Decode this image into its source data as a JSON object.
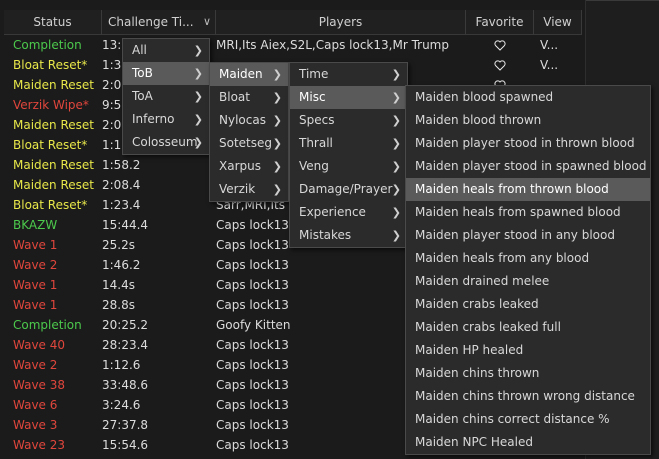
{
  "colors": {
    "green": "#4cc94c",
    "yellow": "#e8e84a",
    "red": "#e0463c",
    "white": "#dcdcdc"
  },
  "header": {
    "status": "Status",
    "challenge_time": "Challenge Ti...",
    "players": "Players",
    "favorite": "Favorite",
    "view": "View"
  },
  "rows": [
    {
      "status": "Completion",
      "color": "green",
      "time": "13:0",
      "players": "MRI,Its Aiex,S2L,Caps lock13,Mr Trump",
      "fav": true,
      "view": "V..."
    },
    {
      "status": "Bloat Reset*",
      "color": "yellow",
      "time": "1:30",
      "players": "",
      "fav": true,
      "view": "V..."
    },
    {
      "status": "Maiden Reset",
      "color": "yellow",
      "time": "2:0",
      "players": "",
      "fav": true,
      "view": ""
    },
    {
      "status": "Verzik Wipe*",
      "color": "red",
      "time": "9:5",
      "players": "",
      "fav": false,
      "view": ""
    },
    {
      "status": "Maiden Reset",
      "color": "yellow",
      "time": "2:0",
      "players": "",
      "fav": false,
      "view": ""
    },
    {
      "status": "Bloat Reset*",
      "color": "yellow",
      "time": "1:10",
      "players": "",
      "fav": false,
      "view": ""
    },
    {
      "status": "Maiden Reset",
      "color": "yellow",
      "time": "1:58.2",
      "players": "",
      "fav": false,
      "view": ""
    },
    {
      "status": "Maiden Reset",
      "color": "yellow",
      "time": "2:08.4",
      "players": "",
      "fav": false,
      "view": ""
    },
    {
      "status": "Bloat Reset*",
      "color": "yellow",
      "time": "1:23.4",
      "players": "Sarr,MRI,Its",
      "fav": false,
      "view": ""
    },
    {
      "status": "BKAZW",
      "color": "green",
      "time": "15:44.4",
      "players": "Caps lock13",
      "fav": false,
      "view": ""
    },
    {
      "status": "Wave 1",
      "color": "red",
      "time": "25.2s",
      "players": "Caps lock13",
      "fav": false,
      "view": ""
    },
    {
      "status": "Wave 2",
      "color": "red",
      "time": "1:46.2",
      "players": "Caps lock13",
      "fav": false,
      "view": ""
    },
    {
      "status": "Wave 1",
      "color": "red",
      "time": "14.4s",
      "players": "Caps lock13",
      "fav": false,
      "view": ""
    },
    {
      "status": "Wave 1",
      "color": "red",
      "time": "28.8s",
      "players": "Caps lock13",
      "fav": false,
      "view": ""
    },
    {
      "status": "Completion",
      "color": "green",
      "time": "20:25.2",
      "players": "Goofy Kitten",
      "fav": false,
      "view": ""
    },
    {
      "status": "Wave 40",
      "color": "red",
      "time": "28:23.4",
      "players": "Caps lock13",
      "fav": false,
      "view": ""
    },
    {
      "status": "Wave 2",
      "color": "red",
      "time": "1:12.6",
      "players": "Caps lock13",
      "fav": false,
      "view": ""
    },
    {
      "status": "Wave 38",
      "color": "red",
      "time": "33:48.6",
      "players": "Caps lock13",
      "fav": false,
      "view": ""
    },
    {
      "status": "Wave 6",
      "color": "red",
      "time": "3:24.6",
      "players": "Caps lock13",
      "fav": false,
      "view": ""
    },
    {
      "status": "Wave 3",
      "color": "red",
      "time": "27:37.8",
      "players": "Caps lock13",
      "fav": false,
      "view": ""
    },
    {
      "status": "Wave 23",
      "color": "red",
      "time": "15:54.6",
      "players": "Caps lock13",
      "fav": false,
      "view": ""
    }
  ],
  "menu1": [
    {
      "label": "All",
      "submenu": true,
      "selected": false
    },
    {
      "label": "ToB",
      "submenu": true,
      "selected": true
    },
    {
      "label": "ToA",
      "submenu": true,
      "selected": false
    },
    {
      "label": "Inferno",
      "submenu": true,
      "selected": false
    },
    {
      "label": "Colosseum",
      "submenu": true,
      "selected": false
    }
  ],
  "menu2": [
    {
      "label": "Maiden",
      "submenu": true,
      "selected": true
    },
    {
      "label": "Bloat",
      "submenu": true,
      "selected": false
    },
    {
      "label": "Nylocas",
      "submenu": true,
      "selected": false
    },
    {
      "label": "Sotetseg",
      "submenu": true,
      "selected": false
    },
    {
      "label": "Xarpus",
      "submenu": true,
      "selected": false
    },
    {
      "label": "Verzik",
      "submenu": true,
      "selected": false
    }
  ],
  "menu3": [
    {
      "label": "Time",
      "submenu": true,
      "selected": false
    },
    {
      "label": "Misc",
      "submenu": true,
      "selected": true
    },
    {
      "label": "Specs",
      "submenu": true,
      "selected": false
    },
    {
      "label": "Thrall",
      "submenu": true,
      "selected": false
    },
    {
      "label": "Veng",
      "submenu": true,
      "selected": false
    },
    {
      "label": "Damage/Prayer",
      "submenu": true,
      "selected": false
    },
    {
      "label": "Experience",
      "submenu": true,
      "selected": false
    },
    {
      "label": "Mistakes",
      "submenu": true,
      "selected": false
    }
  ],
  "menu4": [
    {
      "label": "Maiden blood spawned",
      "submenu": false,
      "selected": false
    },
    {
      "label": "Maiden blood thrown",
      "submenu": false,
      "selected": false
    },
    {
      "label": "Maiden player stood in thrown blood",
      "submenu": false,
      "selected": false
    },
    {
      "label": "Maiden player stood in spawned blood",
      "submenu": false,
      "selected": false
    },
    {
      "label": "Maiden heals from thrown blood",
      "submenu": false,
      "selected": true
    },
    {
      "label": "Maiden heals from spawned blood",
      "submenu": false,
      "selected": false
    },
    {
      "label": "Maiden player stood in any blood",
      "submenu": false,
      "selected": false
    },
    {
      "label": "Maiden heals from any blood",
      "submenu": false,
      "selected": false
    },
    {
      "label": "Maiden drained melee",
      "submenu": false,
      "selected": false
    },
    {
      "label": "Maiden crabs leaked",
      "submenu": false,
      "selected": false
    },
    {
      "label": "Maiden crabs leaked full",
      "submenu": false,
      "selected": false
    },
    {
      "label": "Maiden HP healed",
      "submenu": false,
      "selected": false
    },
    {
      "label": "Maiden chins thrown",
      "submenu": false,
      "selected": false
    },
    {
      "label": "Maiden chins thrown wrong distance",
      "submenu": false,
      "selected": false
    },
    {
      "label": "Maiden chins correct distance %",
      "submenu": false,
      "selected": false
    },
    {
      "label": "Maiden NPC Healed",
      "submenu": false,
      "selected": false
    }
  ]
}
